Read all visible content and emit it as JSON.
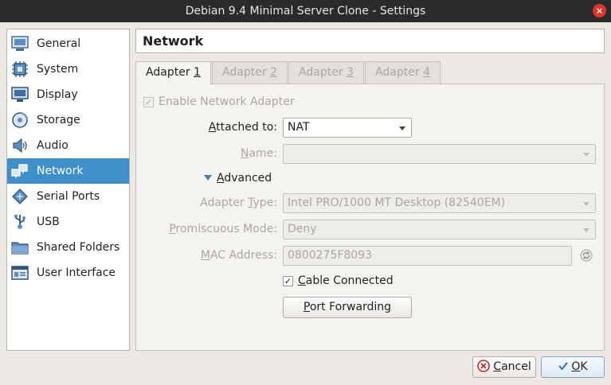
{
  "window": {
    "title": "Debian 9.4 Minimal Server Clone - Settings",
    "close_glyph": "×"
  },
  "sidebar": {
    "items": [
      {
        "label": "General",
        "icon": "general-icon"
      },
      {
        "label": "System",
        "icon": "system-icon"
      },
      {
        "label": "Display",
        "icon": "display-icon"
      },
      {
        "label": "Storage",
        "icon": "storage-icon"
      },
      {
        "label": "Audio",
        "icon": "audio-icon"
      },
      {
        "label": "Network",
        "icon": "network-icon",
        "active": true
      },
      {
        "label": "Serial Ports",
        "icon": "serial-ports-icon"
      },
      {
        "label": "USB",
        "icon": "usb-icon"
      },
      {
        "label": "Shared Folders",
        "icon": "shared-folders-icon"
      },
      {
        "label": "User Interface",
        "icon": "user-interface-icon"
      }
    ]
  },
  "page": {
    "title": "Network"
  },
  "tabs": [
    {
      "pre": "Adapter ",
      "ul": "1",
      "active": true
    },
    {
      "pre": "Adapter ",
      "ul": "2"
    },
    {
      "pre": "Adapter ",
      "ul": "3"
    },
    {
      "pre": "Adapter ",
      "ul": "4"
    }
  ],
  "form": {
    "enable_adapter_label": "Enable Network Adapter",
    "enable_adapter_checked": true,
    "attached_to_label_ul": "A",
    "attached_to_label_rest": "ttached to:",
    "attached_to_value": "NAT",
    "name_label_pre": "",
    "name_label_ul": "N",
    "name_label_rest": "ame:",
    "name_value": "",
    "advanced_label_ul": "A",
    "advanced_label_rest": "dvanced",
    "adapter_type_label_pre": "Adapter ",
    "adapter_type_label_ul": "T",
    "adapter_type_label_rest": "ype:",
    "adapter_type_value": "Intel PRO/1000 MT Desktop (82540EM)",
    "promiscuous_label_ul": "P",
    "promiscuous_label_rest": "romiscuous Mode:",
    "promiscuous_value": "Deny",
    "mac_label_pre": "",
    "mac_label_ul": "M",
    "mac_label_rest": "AC Address:",
    "mac_value": "0800275F8093",
    "cable_connected_ul": "C",
    "cable_connected_rest": "able Connected",
    "cable_connected_checked": true,
    "port_forwarding_ul": "P",
    "port_forwarding_rest": "ort Forwarding"
  },
  "buttons": {
    "cancel_ul": "C",
    "cancel_rest": "ancel",
    "ok_ul": "O",
    "ok_rest": "K"
  },
  "colors": {
    "accent": "#3d8ec9",
    "titlebar": "#2b2b2b",
    "close": "#e0352b"
  }
}
